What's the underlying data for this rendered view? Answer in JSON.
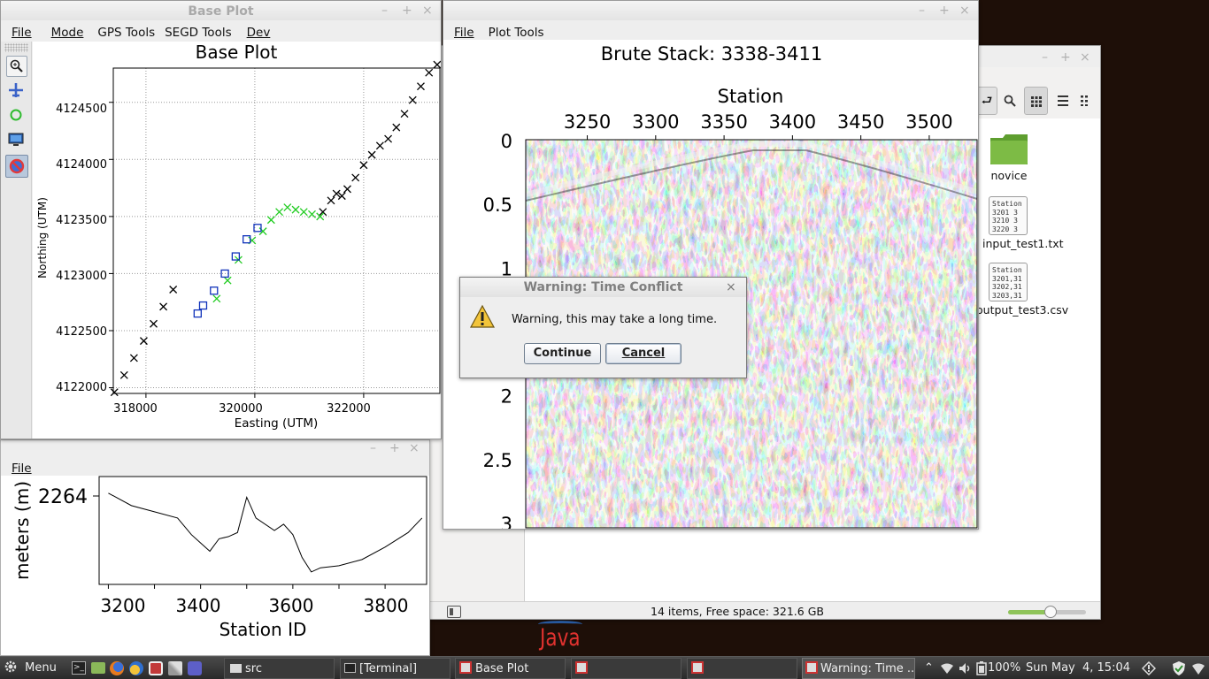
{
  "desktop": {
    "java_logo": "Java"
  },
  "file_manager": {
    "toolbar_icons": [
      "go-back-icon",
      "search-icon",
      "grid-view-icon",
      "list-view-icon",
      "compact-view-icon"
    ],
    "items": [
      {
        "name": "novice",
        "type": "folder"
      },
      {
        "name": "input_test1.txt",
        "type": "text",
        "preview": [
          "Station",
          "3201   3",
          "3210   3",
          "3220   3"
        ]
      },
      {
        "name": "output_test3.csv",
        "type": "text",
        "preview": [
          "Station",
          "3201,31",
          "3202,31",
          "3203,31"
        ]
      }
    ],
    "status": "14 items, Free space: 321.6 GB",
    "zoom": 0.55
  },
  "base_plot": {
    "window_title": "Base Plot",
    "menu": [
      "File",
      "Mode",
      "GPS Tools",
      "SEGD Tools",
      "Dev"
    ],
    "tools": [
      "zoom-icon",
      "airplane-icon",
      "circle-icon",
      "monitor-icon",
      "no-entry-icon"
    ],
    "chart_title": "Base Plot",
    "xlabel": "Easting (UTM)",
    "ylabel": "Northing (UTM)",
    "xticks": [
      "318000",
      "320000",
      "322000"
    ],
    "yticks": [
      "4124500",
      "4124000",
      "4123500",
      "4123000",
      "4122500",
      "4122000"
    ]
  },
  "elevation": {
    "menu": [
      "File"
    ],
    "ylabel": "meters (m)",
    "ytick": "2264",
    "xlabel": "Station ID",
    "xticks": [
      "3200",
      "3400",
      "3600",
      "3800"
    ]
  },
  "brute": {
    "menu": [
      "File",
      "Plot Tools"
    ],
    "title": "Brute Stack: 3338-3411",
    "xlabel": "Station",
    "xticks": [
      "3250",
      "3300",
      "3350",
      "3400",
      "3450",
      "3500"
    ],
    "yticks": [
      "0",
      "0.5",
      "1",
      "2",
      "2.5",
      "3"
    ]
  },
  "dialog": {
    "title": "Warning: Time Conflict",
    "message": "Warning, this may take a long time.",
    "continue_label": "Continue",
    "cancel_label": "Cancel"
  },
  "taskbar": {
    "menu_label": "Menu",
    "windows": [
      "src",
      "[Terminal]",
      "Base Plot",
      "",
      "",
      "Warning: Time ..."
    ],
    "battery": "100%",
    "clock": "Sun May  4, 15:04"
  },
  "chart_data": [
    {
      "type": "scatter",
      "title": "Base Plot",
      "xlabel": "Easting (UTM)",
      "ylabel": "Northing (UTM)",
      "xlim": [
        317400,
        323400
      ],
      "ylim": [
        4121950,
        4124800
      ],
      "grid": true,
      "series": [
        {
          "marker": "x",
          "color": "#000000",
          "points": [
            [
              317420,
              4121960
            ],
            [
              317600,
              4122110
            ],
            [
              317780,
              4122260
            ],
            [
              317960,
              4122410
            ],
            [
              318140,
              4122560
            ],
            [
              318320,
              4122710
            ],
            [
              318500,
              4122860
            ],
            [
              321250,
              4123540
            ],
            [
              321400,
              4123640
            ],
            [
              321500,
              4123700
            ],
            [
              321600,
              4123680
            ],
            [
              321700,
              4123740
            ],
            [
              321850,
              4123840
            ],
            [
              322000,
              4123950
            ],
            [
              322150,
              4124040
            ],
            [
              322300,
              4124120
            ],
            [
              322450,
              4124180
            ],
            [
              322600,
              4124280
            ],
            [
              322750,
              4124400
            ],
            [
              322900,
              4124520
            ],
            [
              323050,
              4124640
            ],
            [
              323200,
              4124760
            ],
            [
              323350,
              4124830
            ]
          ]
        },
        {
          "marker": "x",
          "color": "#22cc22",
          "points": [
            [
              319300,
              4122780
            ],
            [
              319500,
              4122940
            ],
            [
              319700,
              4123120
            ],
            [
              319950,
              4123290
            ],
            [
              320150,
              4123370
            ],
            [
              320300,
              4123470
            ],
            [
              320450,
              4123540
            ],
            [
              320600,
              4123580
            ],
            [
              320750,
              4123560
            ],
            [
              320900,
              4123540
            ],
            [
              321050,
              4123520
            ],
            [
              321200,
              4123500
            ]
          ]
        },
        {
          "marker": "square",
          "color": "#1133bb",
          "points": [
            [
              318950,
              4122650
            ],
            [
              319050,
              4122720
            ],
            [
              319250,
              4122850
            ],
            [
              319450,
              4123000
            ],
            [
              319650,
              4123150
            ],
            [
              319850,
              4123300
            ],
            [
              320050,
              4123400
            ]
          ]
        }
      ]
    },
    {
      "type": "line",
      "xlabel": "Station ID",
      "ylabel": "meters (m)",
      "xlim": [
        3180,
        3890
      ],
      "series": [
        {
          "x": [
            3200,
            3250,
            3300,
            3350,
            3380,
            3400,
            3420,
            3440,
            3460,
            3480,
            3500,
            3520,
            3560,
            3580,
            3600,
            3620,
            3640,
            3660,
            3700,
            3750,
            3800,
            3850,
            3880
          ],
          "y": [
            2264,
            2258,
            2255,
            2252,
            2244,
            2240,
            2236,
            2242,
            2243,
            2245,
            2262,
            2252,
            2246,
            2249,
            2244,
            2233,
            2226,
            2228,
            2229,
            2232,
            2238,
            2245,
            2252
          ]
        }
      ]
    },
    {
      "type": "heatmap",
      "title": "Brute Stack: 3338-3411",
      "xlabel": "Station",
      "xlim": [
        3205,
        3535
      ],
      "ylim": [
        3,
        0
      ],
      "xticks": [
        3250,
        3300,
        3350,
        3400,
        3450,
        3500
      ],
      "yticks": [
        0,
        0.5,
        1,
        2,
        2.5,
        3
      ]
    }
  ]
}
